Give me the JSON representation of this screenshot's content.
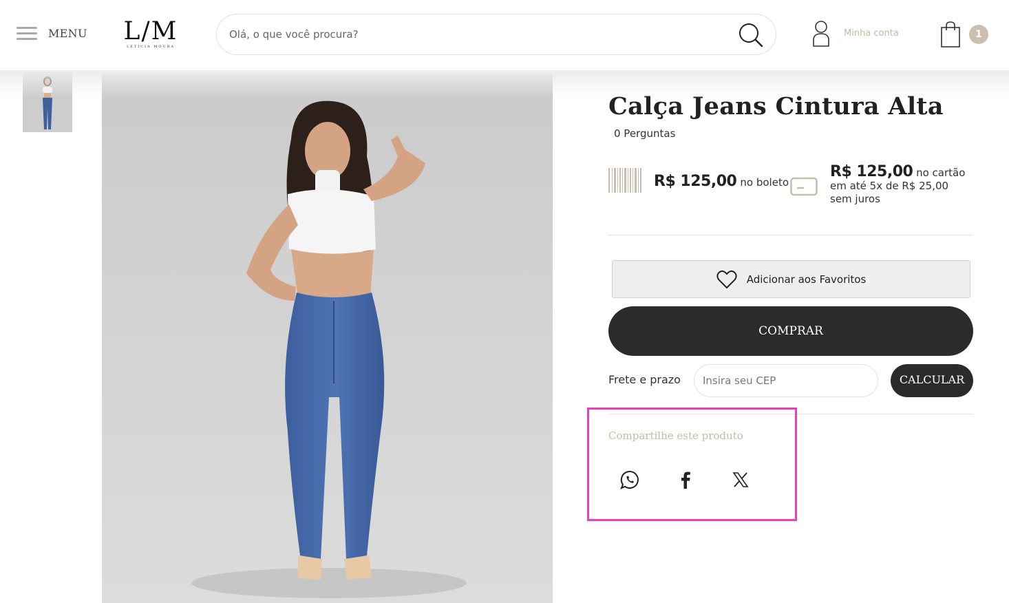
{
  "header": {
    "menu_label": "MENU",
    "logo_mark": "L/M",
    "logo_sub": "LETICIA MOURA",
    "search_placeholder": "Olá, o que você procura?",
    "account_label": "Minha conta",
    "cart_count": "1"
  },
  "product": {
    "title": "Calça Jeans Cintura Alta",
    "questions": "0 Perguntas",
    "boleto_price": "R$ 125,00",
    "boleto_suffix": "no boleto",
    "card_price": "R$ 125,00",
    "card_suffix": "no cartão",
    "card_installments": "em até 5x de R$ 25,00",
    "card_interest": "sem juros",
    "favorites_label": "Adicionar aos Favoritos",
    "buy_label": "COMPRAR",
    "shipping_label": "Frete e prazo",
    "cep_placeholder": "Insira seu CEP",
    "calc_label": "CALCULAR"
  },
  "share": {
    "title": "Compartilhe este produto",
    "icons": [
      "whatsapp-icon",
      "facebook-icon",
      "x-twitter-icon"
    ]
  },
  "colors": {
    "accent_beige": "#c9b8a6",
    "dark_button": "#2b2b2b",
    "highlight_border": "#ee3fb8"
  }
}
